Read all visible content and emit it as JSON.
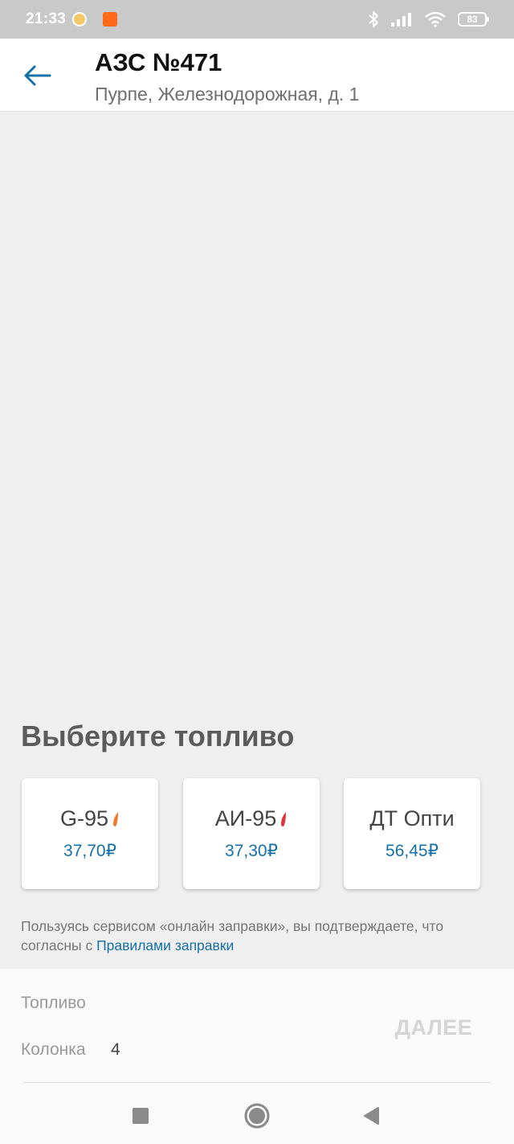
{
  "status_bar": {
    "time": "21:33",
    "battery": "83",
    "icons": [
      "notification-app-icon",
      "mi-app-icon",
      "bluetooth-icon",
      "signal-icon",
      "wifi-icon",
      "battery-icon"
    ]
  },
  "header": {
    "title": "АЗС №471",
    "subtitle": "Пурпе, Железнодорожная, д. 1",
    "back_icon": "arrow-left-icon"
  },
  "fuel_section": {
    "heading": "Выберите топливо",
    "fuels": [
      {
        "name": "G-95",
        "price": "37,70₽",
        "flame_color": "#f07a2b"
      },
      {
        "name": "АИ-95",
        "price": "37,30₽",
        "flame_color": "#e0343b"
      },
      {
        "name": "ДТ Опти",
        "price": "56,45₽"
      }
    ]
  },
  "terms": {
    "text": "Пользуясь сервисом «онлайн заправки», вы подтверждаете, что согласны с ",
    "link": "Правилами заправки"
  },
  "order_panel": {
    "fuel_label": "Топливо",
    "pump_label": "Колонка",
    "pump_value": "4",
    "next_button": "ДАЛЕЕ"
  },
  "colors": {
    "accent": "#1570a6",
    "background": "#efefef",
    "status_bar": "#c9c9c9"
  }
}
